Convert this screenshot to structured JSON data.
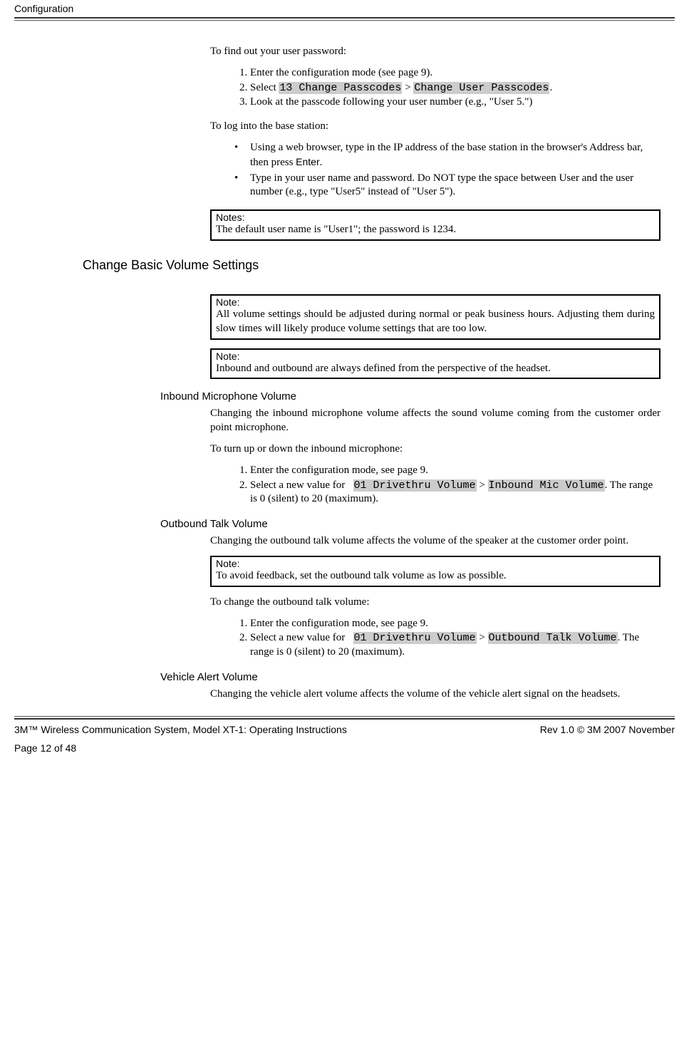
{
  "header": {
    "title": "Configuration"
  },
  "intro": {
    "find_password": "To find out your user password:",
    "steps_find": {
      "s1": "Enter the configuration mode (see page 9).",
      "s2_pre": "Select  ",
      "s2_code1": "13 Change Passcodes",
      "s2_gap": " > ",
      "s2_code2": "Change User Passcodes",
      "s2_post": ".",
      "s3": "Look at the passcode following your user number (e.g., \"User 5.\")"
    },
    "login_heading": "To log into the base station:",
    "login_bullets": {
      "b1_pre": "Using a web browser, type in the IP address of the base station in the browser's Address bar, then press ",
      "b1_enter": "Enter",
      "b1_post": ".",
      "b2": "Type in your user name and password.  Do NOT type the space between User and the user number (e.g., type \"User5\" instead of \"User 5\")."
    },
    "note1_title": "Notes:",
    "note1_body": "The default user name is \"User1\"; the password is 1234."
  },
  "volume": {
    "heading": "Change Basic Volume Settings",
    "note2_title": "Note:",
    "note2_body": "All volume settings should be adjusted during normal or peak business hours. Adjusting them during slow times will likely produce volume settings that are too low.",
    "note3_title": "Note:",
    "note3_body": "Inbound and outbound are always defined from the perspective of the headset."
  },
  "inbound": {
    "heading": "Inbound Microphone Volume",
    "para": "Changing the inbound microphone volume affects the sound volume coming from the customer order point microphone.",
    "lead": "To turn up or down the inbound microphone:",
    "s1": "Enter the configuration mode, see page 9.",
    "s2_pre": "Select a new value for   ",
    "s2_code1": "01 Drivethru Volume",
    "s2_gap": " > ",
    "s2_code2": "Inbound Mic Volume",
    "s2_post": ".  The range is 0 (silent) to 20 (maximum)."
  },
  "outbound": {
    "heading": "Outbound Talk Volume",
    "para": "Changing the outbound talk volume affects the volume of the speaker at the customer order point.",
    "note_title": "Note:",
    "note_body": "To avoid feedback, set the outbound talk volume as low as possible.",
    "lead": "To change the outbound talk volume:",
    "s1": "Enter the configuration mode, see page 9.",
    "s2_pre": "Select a new value for   ",
    "s2_code1": "01 Drivethru Volume",
    "s2_gap": " > ",
    "s2_code2": "Outbound Talk Volume",
    "s2_post": ".  The range is 0 (silent) to 20 (maximum)."
  },
  "vehicle": {
    "heading": "Vehicle Alert Volume",
    "para": "Changing the vehicle alert volume affects the volume of the vehicle alert signal on the headsets."
  },
  "footer": {
    "left": "3M™ Wireless Communication System, Model XT-1: Operating Instructions",
    "right": "Rev 1.0 © 3M 2007 November",
    "page": "Page 12 of 48"
  }
}
